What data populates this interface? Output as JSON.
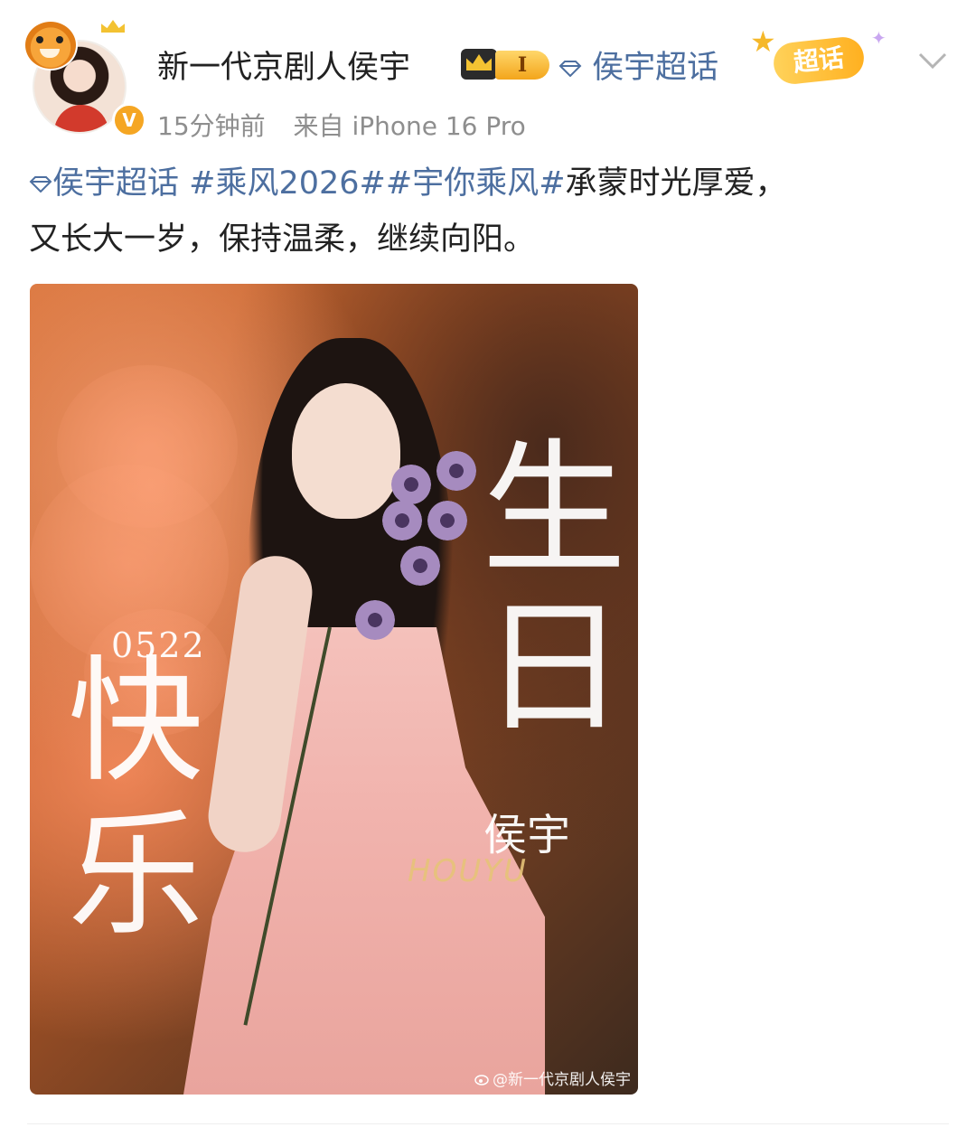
{
  "post": {
    "username": "新一代京剧人侯宇",
    "level_label": "I",
    "supertopic_link": "侯宇超话",
    "chaohua_badge": "超话",
    "time": "15分钟前",
    "source": "来自 iPhone 16 Pro",
    "text": {
      "topic_supertopic": "侯宇超话",
      "hashtag1": "#乘风2026#",
      "hashtag2": "#宇你乘风#",
      "body_line1": "承蒙时光厚爱，",
      "body_line2": "又长大一岁，保持温柔，继续向阳。"
    }
  },
  "image": {
    "date": "0522",
    "kuai": "快",
    "le": "乐",
    "sheng": "生",
    "ri": "日",
    "signature_cn": "侯宇",
    "signature_en": "HOUYU",
    "watermark": "@新一代京剧人侯宇"
  },
  "colors": {
    "link": "#4d6fa0",
    "text": "#222222",
    "meta": "#8e8e8e",
    "vip_gold": "#f3c232"
  },
  "icons": {
    "verified": "verified-v-badge",
    "supertopic": "diamond-icon",
    "more": "chevron-down-icon"
  }
}
